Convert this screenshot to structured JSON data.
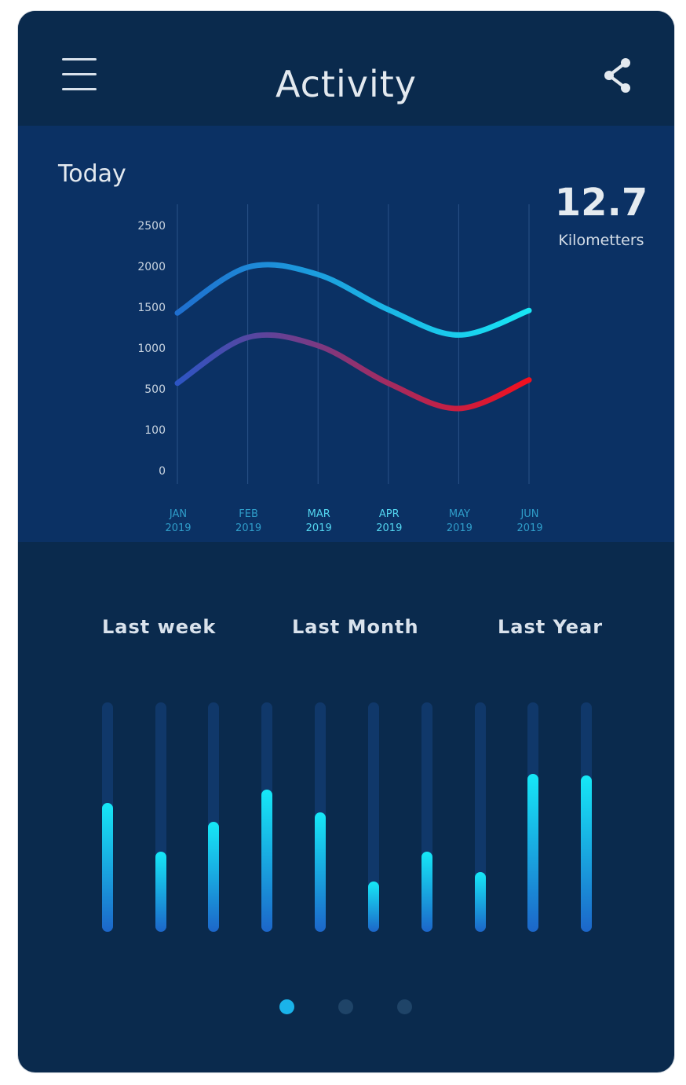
{
  "header": {
    "title": "Activity",
    "menu_icon": "hamburger-menu-icon",
    "share_icon": "share-icon"
  },
  "today_panel": {
    "label": "Today",
    "value": "12.7",
    "unit": "Kilometters"
  },
  "chart_data": {
    "type": "line",
    "y_ticks": [
      "2500",
      "2000",
      "1500",
      "1000",
      "500",
      "100",
      "0"
    ],
    "x_ticks": [
      {
        "month": "JAN",
        "year": "2019"
      },
      {
        "month": "FEB",
        "year": "2019"
      },
      {
        "month": "MAR",
        "year": "2019"
      },
      {
        "month": "APR",
        "year": "2019"
      },
      {
        "month": "MAY",
        "year": "2019"
      },
      {
        "month": "JUN",
        "year": "2019"
      }
    ],
    "series": [
      {
        "color_start": "#1f6fcf",
        "color_end": "#18e6f5",
        "values": [
          1420,
          1980,
          1890,
          1460,
          1150,
          1450
        ]
      },
      {
        "color_start": "#2d55c4",
        "color_end": "#f2101e",
        "values": [
          560,
          1120,
          1020,
          560,
          300,
          600
        ]
      }
    ],
    "ylim": [
      0,
      2500
    ]
  },
  "periods": [
    "Last week",
    "Last Month",
    "Last Year"
  ],
  "bar_levels": [
    0.56,
    0.35,
    0.48,
    0.62,
    0.52,
    0.22,
    0.35,
    0.26,
    0.69,
    0.68
  ],
  "pagination": {
    "count": 3,
    "active": 0
  },
  "colors": {
    "background": "#0a2a4d",
    "chart_panel": "#0b3164",
    "accent": "#1ab3ea"
  }
}
